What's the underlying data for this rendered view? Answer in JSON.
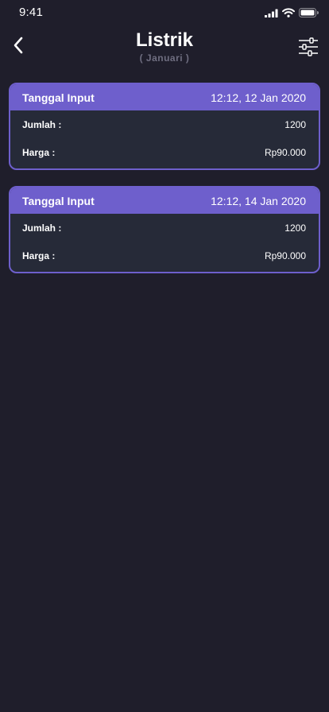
{
  "status_bar": {
    "time": "9:41",
    "icons": [
      "signal-icon",
      "wifi-icon",
      "battery-icon"
    ]
  },
  "header": {
    "title": "Listrik",
    "subtitle": "( Januari )",
    "back_icon": "chevron-left-icon",
    "filter_icon": "sliders-icon"
  },
  "records": [
    {
      "head_label": "Tanggal Input",
      "date": "12:12, 12 Jan 2020",
      "amount_label": "Jumlah :",
      "amount": "1200",
      "price_label": "Harga :",
      "price": "Rp90.000"
    },
    {
      "head_label": "Tanggal Input",
      "date": "12:12, 14 Jan 2020",
      "amount_label": "Jumlah :",
      "amount": "1200",
      "price_label": "Harga :",
      "price": "Rp90.000"
    }
  ],
  "colors": {
    "background": "#1f1e2b",
    "card_bg": "#262a38",
    "accent": "#6e5fcc",
    "muted": "#6f6e80"
  }
}
